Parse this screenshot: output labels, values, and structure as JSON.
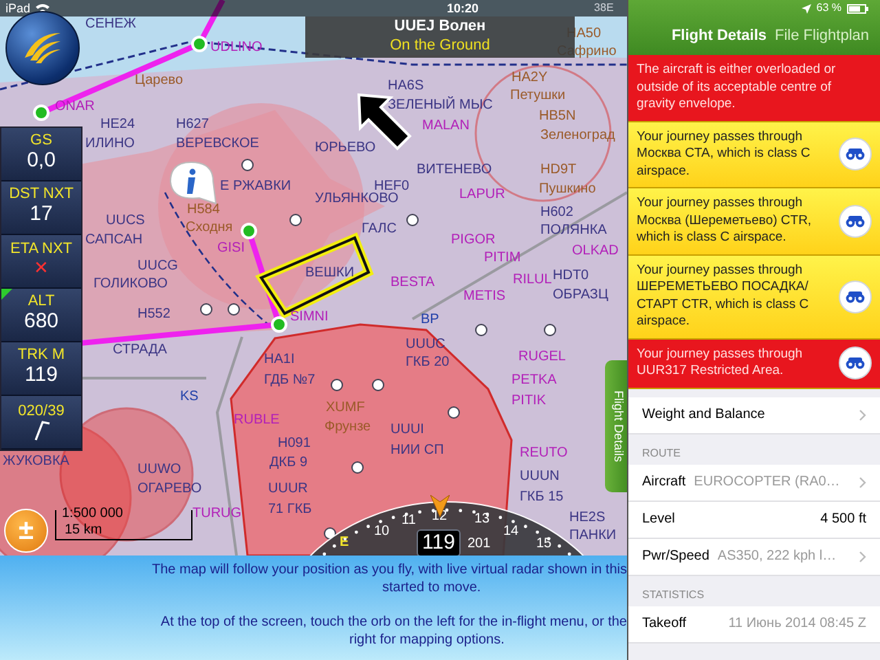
{
  "status_bar": {
    "device": "iPad",
    "time": "10:20",
    "grid": "38E",
    "battery": "63 %"
  },
  "airfield": {
    "title": "UUEJ Волен",
    "status": "On the Ground"
  },
  "instruments": [
    {
      "kind": "text",
      "label": "GS",
      "value": "0,0"
    },
    {
      "kind": "text",
      "label": "DST NXT",
      "value": "17"
    },
    {
      "kind": "cross",
      "label": "ETA NXT",
      "value": "✕"
    },
    {
      "kind": "text",
      "label": "ALT",
      "value": "680"
    },
    {
      "kind": "text",
      "label": "TRK M",
      "value": "119"
    },
    {
      "kind": "wind",
      "label": "020/39"
    }
  ],
  "map": {
    "labels": [
      {
        "text": "СЕНЕЖ",
        "kind": "place"
      },
      {
        "text": "UDLINO",
        "kind": "waypoint"
      },
      {
        "text": "Царево",
        "kind": "town"
      },
      {
        "text": "ONAR",
        "kind": "waypoint"
      },
      {
        "text": "HE24",
        "kind": "place"
      },
      {
        "text": "H627",
        "kind": "place"
      },
      {
        "text": "ИЛИНО",
        "kind": "place"
      },
      {
        "text": "ВЕРЕВСКОЕ",
        "kind": "place"
      },
      {
        "text": "Е РЖАВКИ",
        "kind": "place"
      },
      {
        "text": "H584",
        "kind": "town"
      },
      {
        "text": "Сходня",
        "kind": "town"
      },
      {
        "text": "UUCS",
        "kind": "place"
      },
      {
        "text": "САПСАН",
        "kind": "place"
      },
      {
        "text": "GISI",
        "kind": "waypoint"
      },
      {
        "text": "UUCG",
        "kind": "place"
      },
      {
        "text": "ГОЛИКОВО",
        "kind": "place"
      },
      {
        "text": "H552",
        "kind": "place"
      },
      {
        "text": "СТРАДА",
        "kind": "place"
      },
      {
        "text": "SIMNI",
        "kind": "waypoint"
      },
      {
        "text": "HA1I",
        "kind": "place"
      },
      {
        "text": "ГДБ №7",
        "kind": "place"
      },
      {
        "text": "KS",
        "kind": "beacon"
      },
      {
        "text": "RUBLE",
        "kind": "waypoint"
      },
      {
        "text": "ЖУКОВКА",
        "kind": "place"
      },
      {
        "text": "UUWO",
        "kind": "place"
      },
      {
        "text": "ОГАРЕВО",
        "kind": "place"
      },
      {
        "text": "TURUG",
        "kind": "waypoint"
      },
      {
        "text": "H091",
        "kind": "place"
      },
      {
        "text": "ДКБ 9",
        "kind": "place"
      },
      {
        "text": "XUMF",
        "kind": "town"
      },
      {
        "text": "Фрунзе",
        "kind": "town"
      },
      {
        "text": "UUUI",
        "kind": "place"
      },
      {
        "text": "НИИ СП",
        "kind": "place"
      },
      {
        "text": "UUUR",
        "kind": "place"
      },
      {
        "text": "71 ГКБ",
        "kind": "place"
      },
      {
        "text": "UUUC",
        "kind": "place"
      },
      {
        "text": "ГКБ 20",
        "kind": "place"
      },
      {
        "text": "ВЕШКИ",
        "kind": "place"
      },
      {
        "text": "ГАЛС",
        "kind": "place"
      },
      {
        "text": "PIGOR",
        "kind": "waypoint"
      },
      {
        "text": "PITIM",
        "kind": "waypoint"
      },
      {
        "text": "RILUL",
        "kind": "waypoint"
      },
      {
        "text": "METIS",
        "kind": "waypoint"
      },
      {
        "text": "BESTA",
        "kind": "waypoint"
      },
      {
        "text": "BP",
        "kind": "beacon"
      },
      {
        "text": "H602",
        "kind": "place"
      },
      {
        "text": "ПОЛЯНКА",
        "kind": "place"
      },
      {
        "text": "OLKAD",
        "kind": "waypoint"
      },
      {
        "text": "HDT0",
        "kind": "place"
      },
      {
        "text": "ОБРАЗЦ",
        "kind": "place"
      },
      {
        "text": "RUGEL",
        "kind": "waypoint"
      },
      {
        "text": "PETKA",
        "kind": "waypoint"
      },
      {
        "text": "PITIK",
        "kind": "waypoint"
      },
      {
        "text": "REUTO",
        "kind": "waypoint"
      },
      {
        "text": "UUUN",
        "kind": "place"
      },
      {
        "text": "ГКБ 15",
        "kind": "place"
      },
      {
        "text": "HE2S",
        "kind": "place"
      },
      {
        "text": "ПАНКИ",
        "kind": "place"
      },
      {
        "text": "HA6S",
        "kind": "place"
      },
      {
        "text": "ЗЕЛЕНЫЙ МЫС",
        "kind": "place"
      },
      {
        "text": "MALAN",
        "kind": "waypoint"
      },
      {
        "text": "ЮРЬЕВО",
        "kind": "place"
      },
      {
        "text": "ВИТЕНЕВО",
        "kind": "place"
      },
      {
        "text": "HEF0",
        "kind": "place"
      },
      {
        "text": "УЛЬЯНКОВО",
        "kind": "place"
      },
      {
        "text": "LAPUR",
        "kind": "waypoint"
      },
      {
        "text": "HA50",
        "kind": "town"
      },
      {
        "text": "Сафрино",
        "kind": "town"
      },
      {
        "text": "HA2Y",
        "kind": "town"
      },
      {
        "text": "Петушки",
        "kind": "town"
      },
      {
        "text": "HB5N",
        "kind": "town"
      },
      {
        "text": "Зеленоград",
        "kind": "town"
      },
      {
        "text": "HD9T",
        "kind": "town"
      },
      {
        "text": "Пушкино",
        "kind": "town"
      }
    ],
    "scale": {
      "ratio": "1:500 000",
      "distance": "15 km"
    },
    "zoom_button": "±",
    "side_tab": "Flight Details"
  },
  "compass": {
    "marks": [
      "E",
      "10",
      "11",
      "12",
      "13",
      "14",
      "15"
    ],
    "heading": "119",
    "bearing": "201"
  },
  "hint": [
    [
      "The map will follow your position as you fly, with live virtual radar shown in this",
      "started to move."
    ],
    [
      "At the top of the screen, touch the orb on the left for the in-flight menu, or the",
      "right for mapping options."
    ]
  ],
  "tabs": [
    {
      "label": "Flight Details",
      "selected": true
    },
    {
      "label": "File Flightplan",
      "selected": false
    }
  ],
  "alerts": [
    {
      "critical": true,
      "text": "The aircraft is either overloaded or outside of its acceptable centre of gravity envelope.",
      "locate": false
    },
    {
      "critical": false,
      "text": "Your journey passes through Москва CTA, which is class C airspace.",
      "locate": true
    },
    {
      "critical": false,
      "text": "Your journey passes through Москва (Шереметьево) CTR, which is class C airspace.",
      "locate": true
    },
    {
      "critical": false,
      "text": "Your journey passes through ШЕРЕМЕТЬЕВО ПОСАДКА/СТАРТ CTR, which is class C airspace.",
      "locate": true
    },
    {
      "critical": true,
      "text": "Your journey passes through UUR317 Restricted Area.",
      "locate": true
    }
  ],
  "details": [
    {
      "kind": "link",
      "label": "Weight and Balance"
    },
    {
      "kind": "header",
      "label": "ROUTE"
    },
    {
      "kind": "link",
      "label": "Aircraft",
      "value": "EUROCOPTER (RA0…"
    },
    {
      "kind": "value",
      "label": "Level",
      "value": "4 500 ft"
    },
    {
      "kind": "link",
      "label": "Pwr/Speed",
      "value": "AS350, 222 kph l…"
    },
    {
      "kind": "header",
      "label": "STATISTICS"
    },
    {
      "kind": "value",
      "label": "Takeoff",
      "value": "11 Июнь 2014 08:45 Z"
    }
  ]
}
